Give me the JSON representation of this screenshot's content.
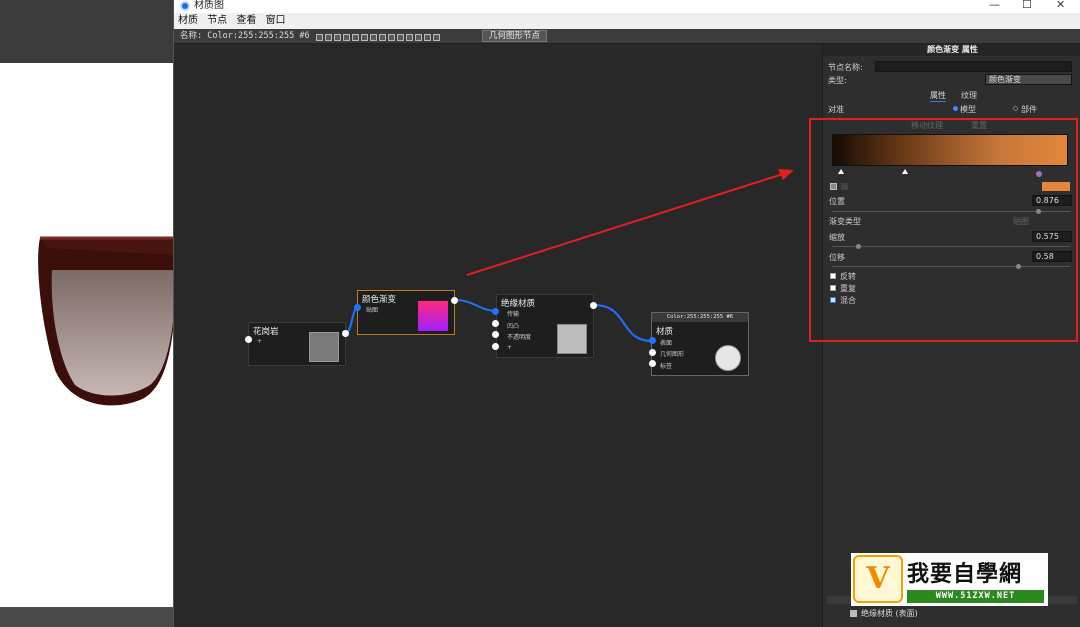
{
  "window": {
    "title": "材质图",
    "controls": [
      "—",
      "☐",
      "✕"
    ]
  },
  "menu": [
    "材质",
    "节点",
    "查看",
    "窗口"
  ],
  "toolbar": {
    "name_label": "名称:",
    "name_value": "Color:255:255:255 #6",
    "geometry_button": "几何图形节点"
  },
  "nodes": {
    "granite": {
      "title": "花岗岩",
      "port": "+"
    },
    "gradient": {
      "title": "颜色渐变",
      "port": "贴图"
    },
    "insulation": {
      "title": "绝缘材质",
      "ports": [
        "传输",
        "凹凸",
        "不透明度",
        "+"
      ]
    },
    "material": {
      "header": "Color:255:255:255 #6",
      "title": "材质",
      "ports": [
        "表面",
        "几何图形",
        "标签"
      ]
    }
  },
  "panel": {
    "header": "颜色渐变 属性",
    "node_name_label": "节点名称:",
    "node_name_value": "",
    "type_label": "类型:",
    "type_value": "颜色渐变",
    "tabs": [
      "属性",
      "纹理"
    ],
    "align_label": "对准",
    "align_options": [
      "模型",
      "部件"
    ],
    "sub_options": [
      "移动纹理",
      "重置"
    ],
    "position_label": "位置",
    "position_value": "0.876",
    "gradient_type_label": "渐变类型",
    "gradient_type_value": "贴图",
    "scale_label": "缩放",
    "scale_value": "0.575",
    "offset_label": "位移",
    "offset_value": "0.58",
    "checkboxes": [
      {
        "label": "反转",
        "checked": false
      },
      {
        "label": "重复",
        "checked": false
      },
      {
        "label": "混合",
        "checked": true
      }
    ],
    "footer_label": "绝缘材质 (表面)"
  },
  "gradient_colors": {
    "start": "#160b04",
    "end": "#e2873c",
    "swatch": "#e2873c"
  },
  "watermark": {
    "brand": "我要自學網",
    "url": "WWW.51ZXW.NET"
  }
}
